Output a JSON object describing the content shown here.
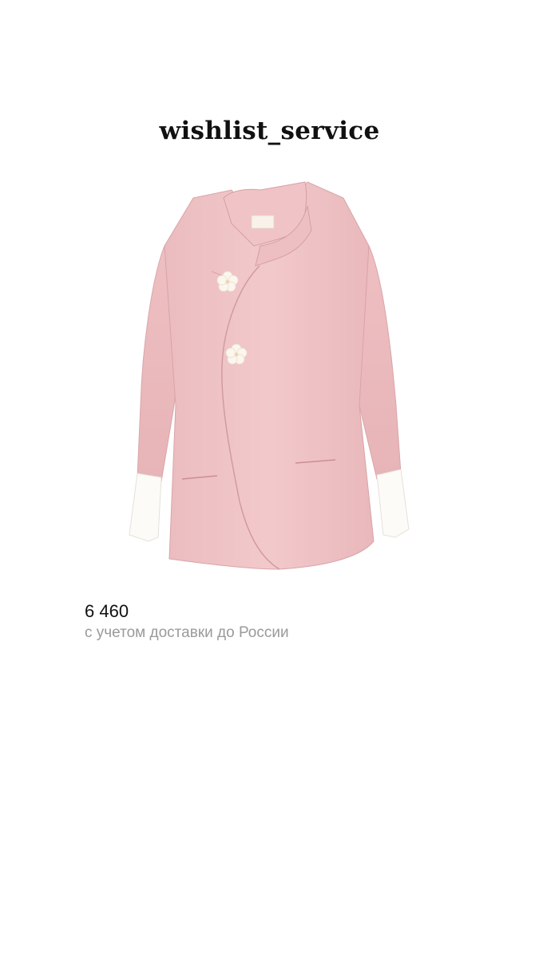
{
  "header": {
    "brand": "wishlist_service"
  },
  "product": {
    "image_icon": "pink-jacket-image",
    "price": "6 460",
    "delivery_note": "с учетом доставки до России"
  }
}
